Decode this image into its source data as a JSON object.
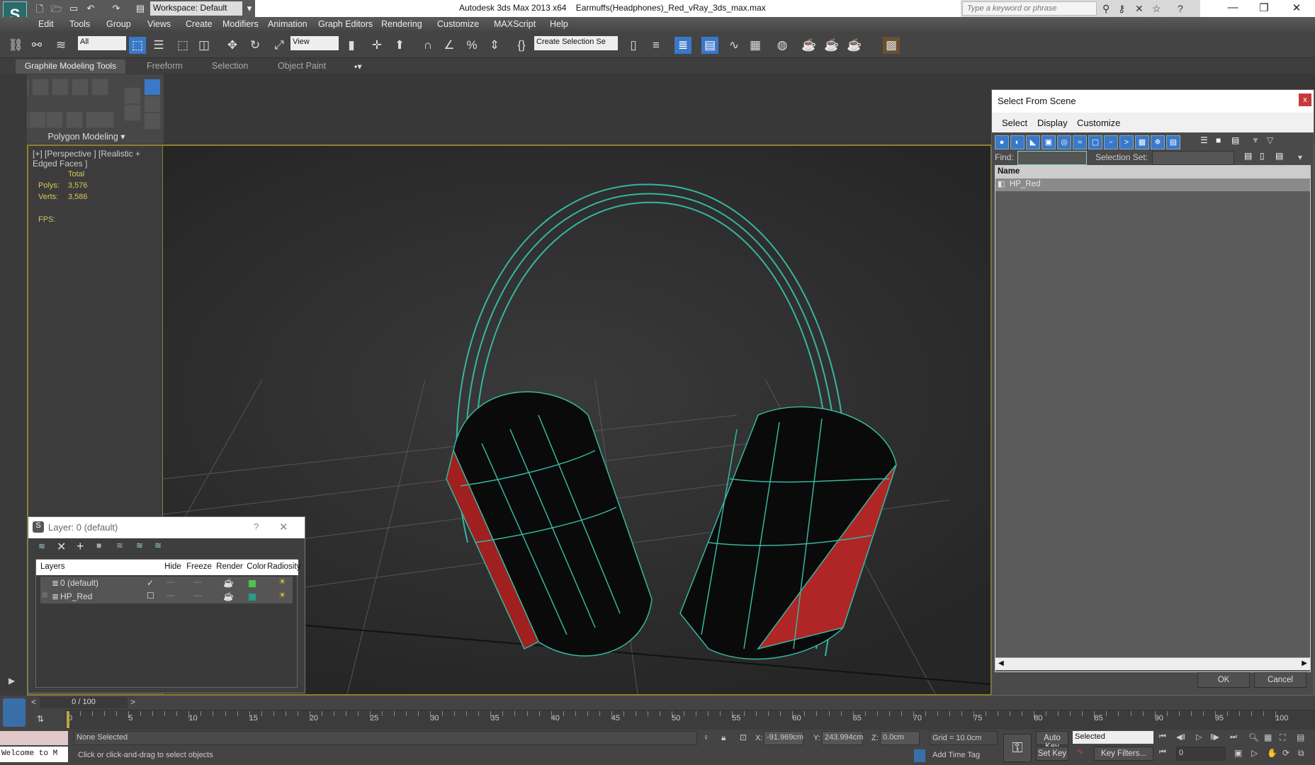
{
  "titlebar": {
    "workspace": "Workspace: Default",
    "app": "Autodesk 3ds Max  2013 x64",
    "file": "Earmuffs(Headphones)_Red_vRay_3ds_max.max",
    "search_placeholder": "Type a keyword or phrase",
    "minimize": "—",
    "restore": "❐",
    "close": "✕"
  },
  "menu": [
    "Edit",
    "Tools",
    "Group",
    "Views",
    "Create",
    "Modifiers",
    "Animation",
    "Graph Editors",
    "Rendering",
    "Customize",
    "MAXScript",
    "Help"
  ],
  "toolbar": {
    "filter": "All",
    "refcoord": "View",
    "selset": "Create Selection Se"
  },
  "ribbon": {
    "tabs": [
      "Graphite Modeling Tools",
      "Freeform",
      "Selection",
      "Object Paint"
    ],
    "panel": "Polygon Modeling ▾"
  },
  "viewport": {
    "label": "[+] [Perspective ] [Realistic + Edged Faces ]",
    "stats": {
      "total": "Total",
      "polys_label": "Polys:",
      "polys": "3,576",
      "verts_label": "Verts:",
      "verts": "3,586",
      "fps_label": "FPS:"
    }
  },
  "select_from_scene": {
    "title": "Select From Scene",
    "close": "x",
    "menu": [
      "Select",
      "Display",
      "Customize"
    ],
    "find_label": "Find:",
    "find_value": "",
    "selset_label": "Selection Set:",
    "col_name": "Name",
    "items": [
      "HP_Red"
    ],
    "ok": "OK",
    "cancel": "Cancel"
  },
  "layer_dialog": {
    "title": "Layer: 0 (default)",
    "help": "?",
    "close": "✕",
    "columns": [
      "Layers",
      "",
      "Hide",
      "Freeze",
      "Render",
      "Color",
      "Radiosity"
    ],
    "rows": [
      {
        "name": "0 (default)",
        "active": "✓",
        "color": "#4fc24f"
      },
      {
        "name": "HP_Red",
        "active": "☐",
        "color": "#2a9a8a"
      }
    ]
  },
  "timeline": {
    "frame": "0 / 100",
    "ticks": [
      "0",
      "5",
      "10",
      "15",
      "20",
      "25",
      "30",
      "35",
      "40",
      "45",
      "50",
      "55",
      "60",
      "65",
      "70",
      "75",
      "80",
      "85",
      "90",
      "95",
      "100"
    ]
  },
  "status": {
    "welcome": "Welcome to M",
    "selection": "None Selected",
    "prompt": "Click or click-and-drag to select objects",
    "x_label": "X:",
    "x": "-91.969cm",
    "y_label": "Y:",
    "y": "243.994cm",
    "z_label": "Z:",
    "z": "0.0cm",
    "grid": "Grid = 10.0cm",
    "add_time_tag": "Add Time Tag",
    "auto_key": "Auto Key",
    "set_key": "Set Key",
    "key_mode": "Selected",
    "key_filters": "Key Filters...",
    "frame_input": "0"
  }
}
